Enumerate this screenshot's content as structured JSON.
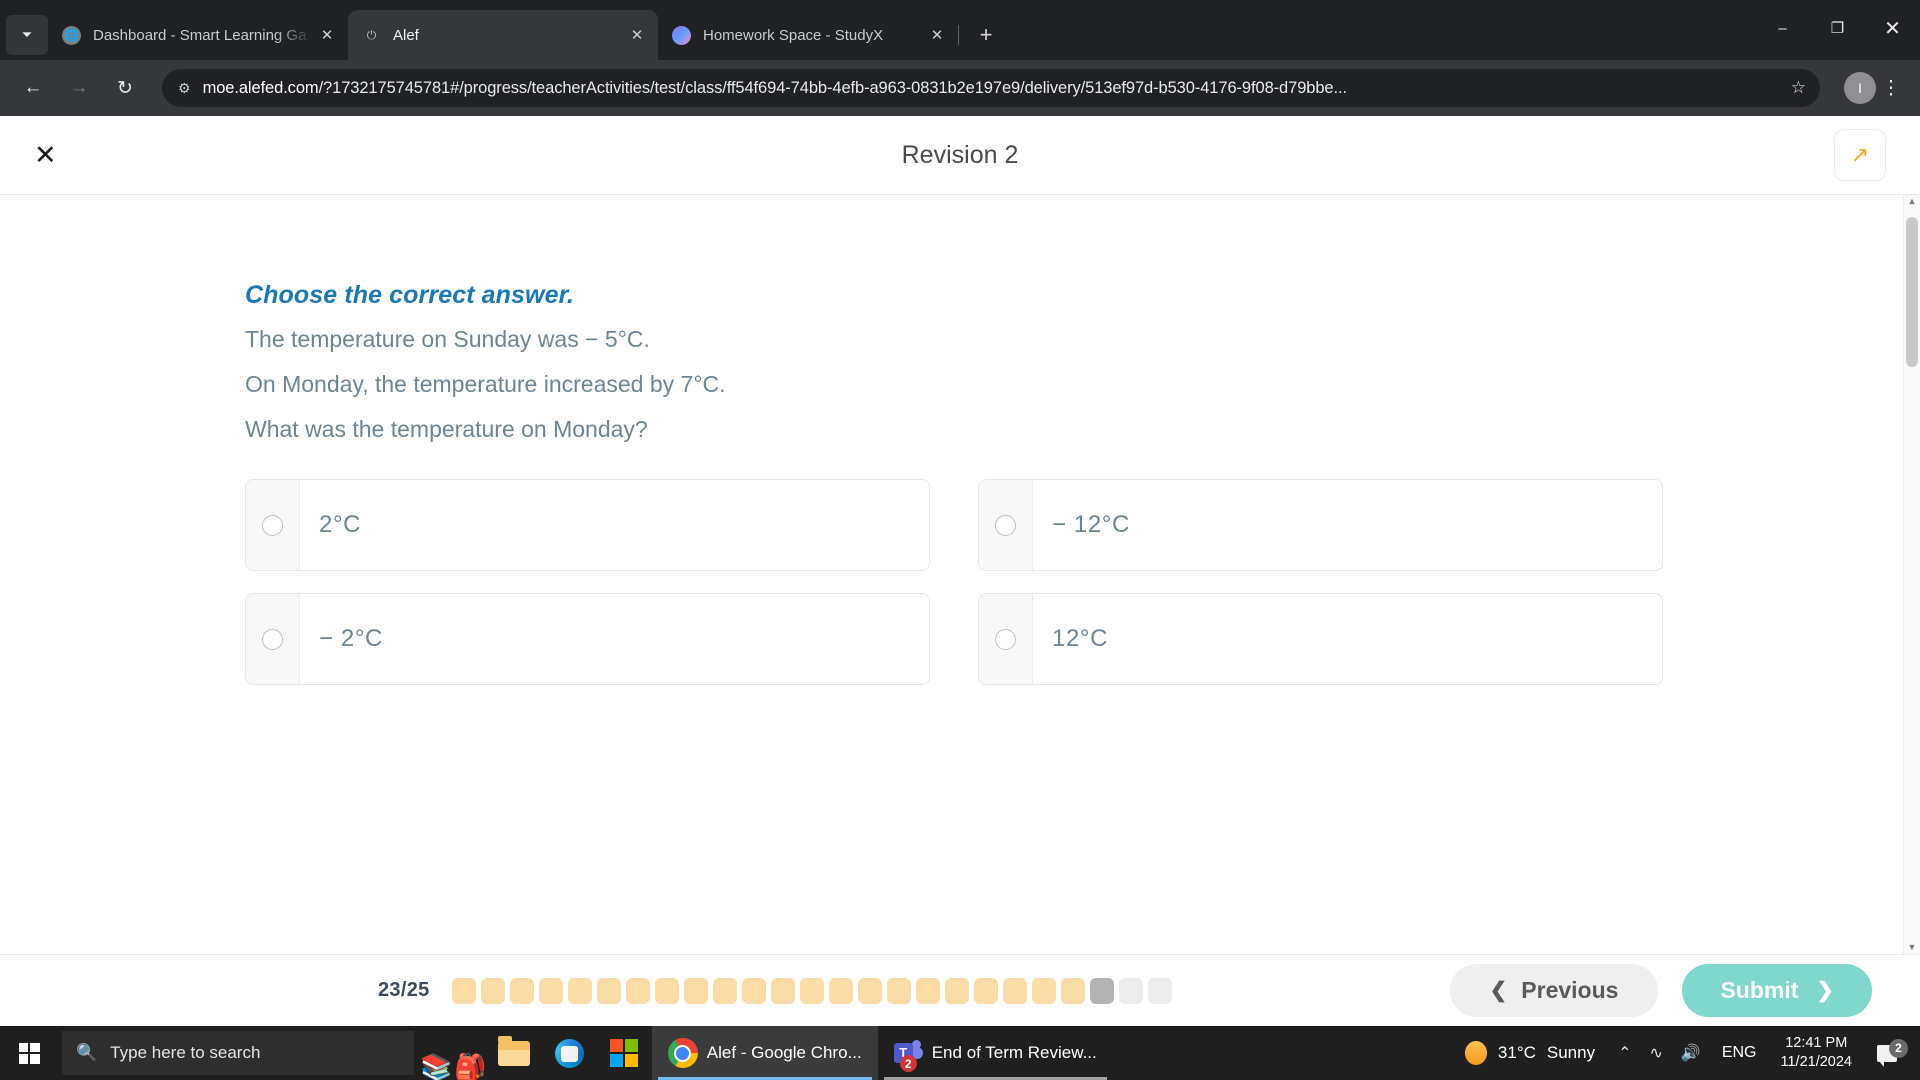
{
  "browser": {
    "tabs": [
      {
        "title": "Dashboard - Smart Learning Ga",
        "favicon": "globe-icon",
        "active": false
      },
      {
        "title": "Alef",
        "favicon": "alef-icon",
        "active": true
      },
      {
        "title": "Homework Space - StudyX",
        "favicon": "studyx-icon",
        "active": false
      }
    ],
    "new_tab_label": "+",
    "tab_list_icon": "chevron-down-icon",
    "window_controls": {
      "minimize": "–",
      "maximize": "❐",
      "close": "✕"
    },
    "nav": {
      "back": "←",
      "forward": "→",
      "reload": "↻"
    },
    "omnibox": {
      "site_info_icon": "site-settings-icon",
      "url_host": "moe.alefed.com",
      "url_path": "/?1732175745781#/progress/teacherActivities/test/class/ff54f694-74bb-4efb-a963-0831b2e197e9/delivery/513ef97d-b530-4176-9f08-d79bbe...",
      "star_icon": "☆"
    },
    "profile_initial": "I",
    "menu_icon": "⋮"
  },
  "app": {
    "header": {
      "close_label": "✕",
      "title": "Revision 2",
      "expand_icon": "↗"
    },
    "question": {
      "heading": "Choose the correct answer.",
      "lines": [
        "The temperature on Sunday was − 5°C.",
        "On Monday, the temperature increased by 7°C.",
        "What was the temperature on Monday?"
      ]
    },
    "options": [
      {
        "label": "2°C",
        "selected": false
      },
      {
        "label": "− 12°C",
        "selected": false
      },
      {
        "label": "− 2°C",
        "selected": false
      },
      {
        "label": "12°C",
        "selected": false
      }
    ],
    "footer": {
      "progress_text": "23/25",
      "segments": [
        "done",
        "done",
        "done",
        "done",
        "done",
        "done",
        "done",
        "done",
        "done",
        "done",
        "done",
        "done",
        "done",
        "done",
        "done",
        "done",
        "done",
        "done",
        "done",
        "done",
        "done",
        "done",
        "current",
        "todo",
        "todo"
      ],
      "previous_label": "Previous",
      "previous_icon": "❮",
      "submit_label": "Submit",
      "submit_icon": "❯",
      "colors": {
        "done": "#fbdba7",
        "current": "#b3b3b3",
        "todo": "#ececec",
        "submit_bg": "#7fd8cb",
        "heading_blue": "#1c78b4",
        "body_text": "#6d8494"
      }
    }
  },
  "taskbar": {
    "start_icon": "windows-logo-icon",
    "search_placeholder": "Type here to search",
    "search_icon": "search-icon",
    "pinned": [
      {
        "name": "school-desk-icon",
        "glyph": "📚"
      },
      {
        "name": "backpack-icon",
        "glyph": "🎒"
      },
      {
        "name": "file-explorer-icon"
      },
      {
        "name": "microsoft-edge-icon"
      },
      {
        "name": "microsoft-store-icon"
      }
    ],
    "tasks": [
      {
        "name": "chrome-task",
        "label": "Alef - Google Chro...",
        "icon": "chrome-icon",
        "active": true,
        "badge": null
      },
      {
        "name": "teams-task",
        "label": "End of Term Review...",
        "icon": "teams-icon",
        "active": false,
        "badge": "2"
      }
    ],
    "tray": {
      "weather_temp": "31°C",
      "weather_cond": "Sunny",
      "weather_icon": "sun-icon",
      "overflow_icon": "⌃",
      "network_icon": "wifi-icon",
      "volume_icon": "🔊",
      "language": "ENG",
      "time": "12:41 PM",
      "date": "11/21/2024",
      "notification_icon": "notification-icon",
      "notification_count": "2"
    }
  }
}
